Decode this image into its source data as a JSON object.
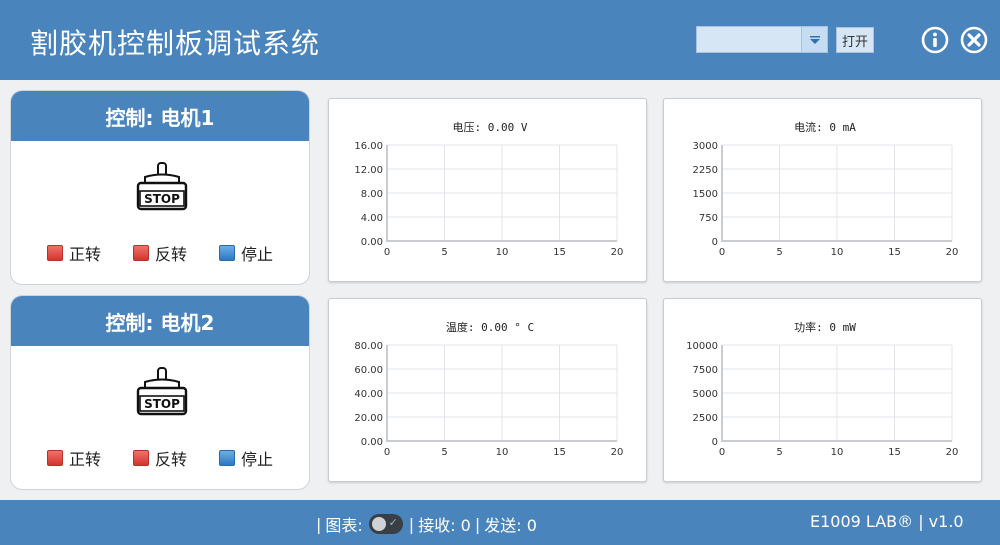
{
  "header": {
    "title": "割胶机控制板调试系统",
    "port_value": "",
    "open_label": "打开",
    "icons": [
      "info-icon",
      "close-icon",
      "chevron-down-icon"
    ]
  },
  "motors": [
    {
      "title": "控制: 电机1",
      "icon": "motor-stop-icon",
      "stop_text": "STOP",
      "forward": "正转",
      "reverse": "反转",
      "stop": "停止"
    },
    {
      "title": "控制: 电机2",
      "icon": "motor-stop-icon",
      "stop_text": "STOP",
      "forward": "正转",
      "reverse": "反转",
      "stop": "停止"
    }
  ],
  "colors": {
    "accent": "#4a84bd",
    "red_button": "#d2362e",
    "blue_button": "#2c79c2"
  },
  "chart_data": [
    {
      "type": "line",
      "title": "电压: 0.00 V",
      "x_ticks": [
        "0",
        "5",
        "10",
        "15",
        "20"
      ],
      "y_ticks": [
        "0.00",
        "4.00",
        "8.00",
        "12.00",
        "16.00"
      ],
      "xlim": [
        0,
        20
      ],
      "ylim": [
        0,
        16
      ],
      "grid": true,
      "series": []
    },
    {
      "type": "line",
      "title": "电流: 0 mA",
      "x_ticks": [
        "0",
        "5",
        "10",
        "15",
        "20"
      ],
      "y_ticks": [
        "0",
        "750",
        "1500",
        "2250",
        "3000"
      ],
      "xlim": [
        0,
        20
      ],
      "ylim": [
        0,
        3000
      ],
      "grid": true,
      "series": []
    },
    {
      "type": "line",
      "title": "温度: 0.00 ° C",
      "x_ticks": [
        "0",
        "5",
        "10",
        "15",
        "20"
      ],
      "y_ticks": [
        "0.00",
        "20.00",
        "40.00",
        "60.00",
        "80.00"
      ],
      "xlim": [
        0,
        20
      ],
      "ylim": [
        0,
        80
      ],
      "grid": true,
      "series": []
    },
    {
      "type": "line",
      "title": "功率: 0 mW",
      "x_ticks": [
        "0",
        "5",
        "10",
        "15",
        "20"
      ],
      "y_ticks": [
        "0",
        "2500",
        "5000",
        "7500",
        "10000"
      ],
      "xlim": [
        0,
        20
      ],
      "ylim": [
        0,
        10000
      ],
      "grid": true,
      "series": []
    }
  ],
  "status": {
    "sep1": "|",
    "chart_label": "图表:",
    "toggle_on": true,
    "sep2": "|",
    "recv": "接收: 0",
    "sep3": "|",
    "send": "发送: 0",
    "brand": "E1009 LAB® |  v1.0"
  }
}
